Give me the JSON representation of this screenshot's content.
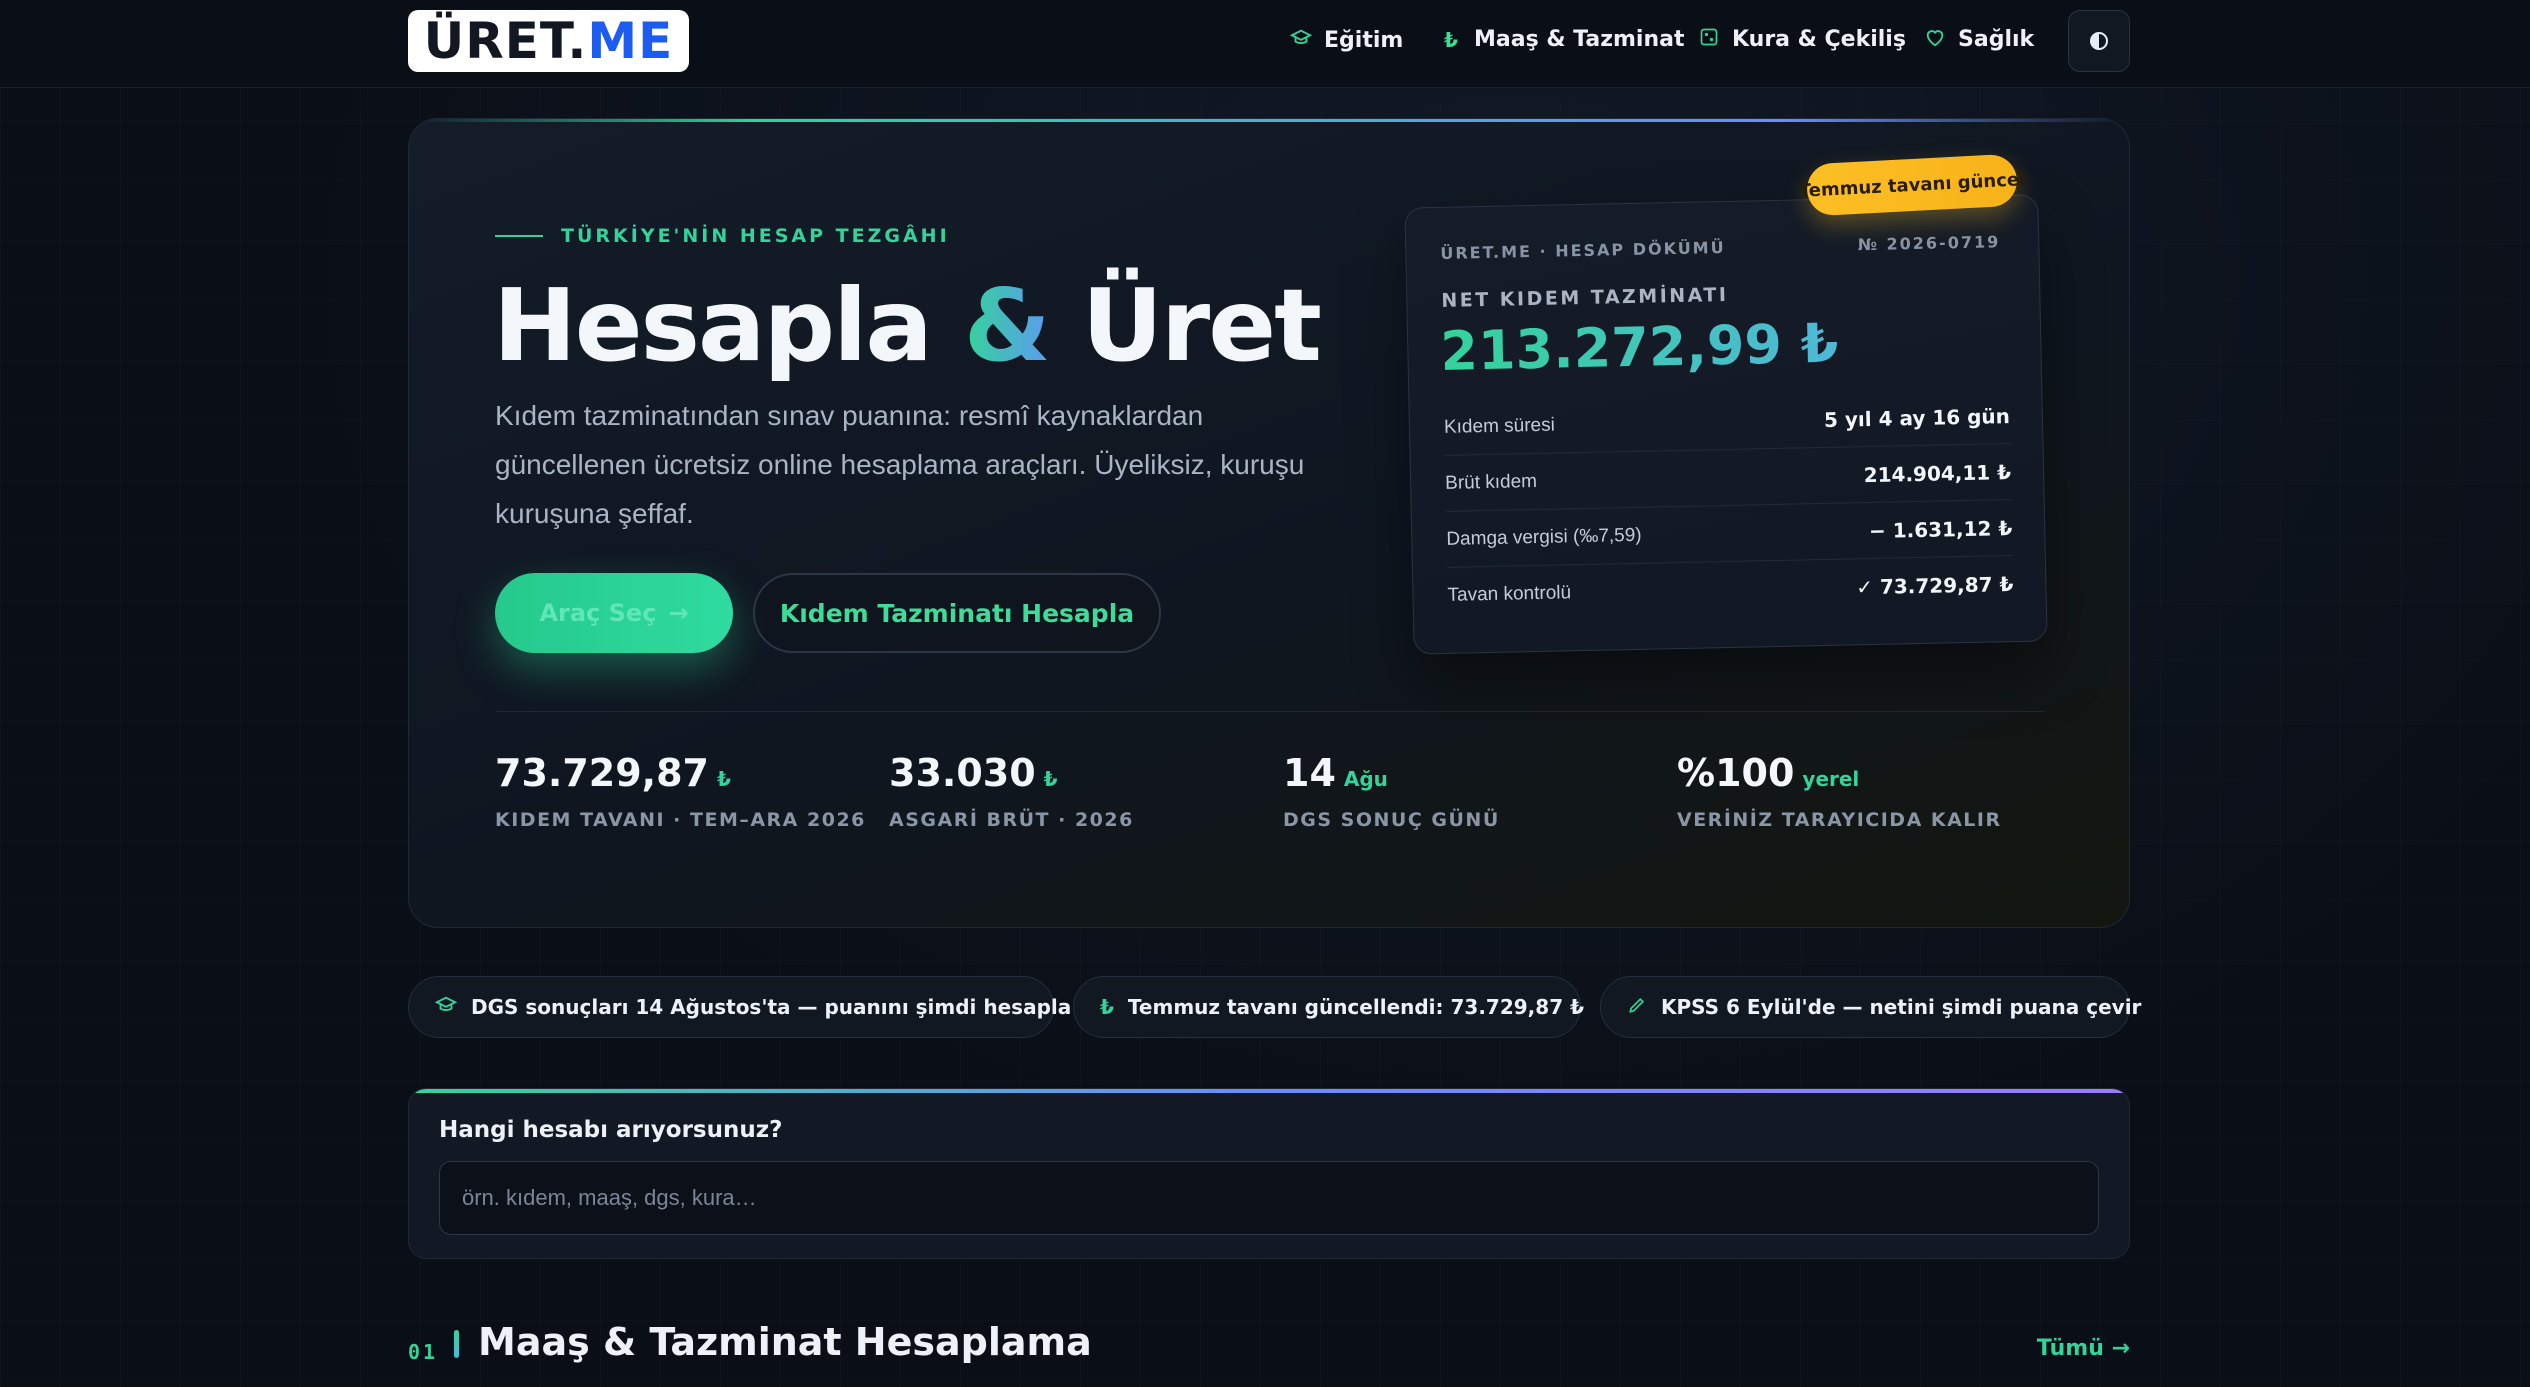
{
  "header": {
    "logo_part1": "ÜRET.",
    "logo_part2": "ME",
    "nav": [
      {
        "label": "Eğitim",
        "icon": "graduation-cap-icon"
      },
      {
        "label": "Maaş & Tazminat",
        "icon": "lira-icon"
      },
      {
        "label": "Kura & Çekiliş",
        "icon": "dice-icon"
      },
      {
        "label": "Sağlık",
        "icon": "heart-icon"
      }
    ],
    "theme_toggle_icon": "contrast-icon"
  },
  "hero": {
    "eyebrow": "TÜRKİYE'NİN HESAP TEZGÂHI",
    "title_part1": "Hesapla",
    "title_amp": "&",
    "title_part2": "Üret",
    "lead": "Kıdem tazminatından sınav puanına: resmî kaynaklardan güncellenen ücretsiz online hesaplama araçları. Üyeliksiz, kuruşu kuruşuna şeffaf.",
    "primary_button": "Araç Seç",
    "primary_button_arrow": "→",
    "secondary_button": "Kıdem Tazminatı Hesapla",
    "stats": [
      {
        "value": "73.729,87",
        "unit": "₺",
        "label": "KIDEM TAVANI · TEM–ARA 2026"
      },
      {
        "value": "33.030",
        "unit": "₺",
        "label": "ASGARİ BRÜT · 2026"
      },
      {
        "value": "14",
        "unit": "Ağu",
        "label": "DGS SONUÇ GÜNÜ"
      },
      {
        "value": "%100",
        "unit": "yerel",
        "label": "VERİNİZ TARAYICIDA KALIR"
      }
    ]
  },
  "receipt": {
    "badge": "Temmuz tavanı güncel",
    "header_left": "ÜRET.ME · HESAP DÖKÜMÜ",
    "header_right": "№ 2026-0719",
    "label": "NET KIDEM TAZMİNATI",
    "amount": "213.272,99 ₺",
    "rows": [
      {
        "key": "Kıdem süresi",
        "value": "5 yıl 4 ay 16 gün"
      },
      {
        "key": "Brüt kıdem",
        "value": "214.904,11 ₺"
      },
      {
        "key": "Damga vergisi (‰7,59)",
        "value": "− 1.631,12 ₺"
      },
      {
        "key": "Tavan kontrolü",
        "value": "✓ 73.729,87 ₺"
      }
    ]
  },
  "announcements": [
    {
      "icon": "graduation-cap-icon",
      "text": "DGS sonuçları 14 Ağustos'ta — puanını şimdi hesapla"
    },
    {
      "icon": "lira-icon",
      "text": "Temmuz tavanı güncellendi: 73.729,87 ₺"
    },
    {
      "icon": "pencil-icon",
      "text": "KPSS 6 Eylül'de — netini şimdi puana çevir"
    }
  ],
  "search": {
    "label": "Hangi hesabı arıyorsunuz?",
    "placeholder": "örn. kıdem, maaş, dgs, kura…",
    "value": ""
  },
  "section": {
    "number": "01",
    "title": "Maaş & Tazminat Hesaplama",
    "all_link": "Tümü →"
  },
  "colors": {
    "accent": "#34d399",
    "background": "#0a0e16",
    "badge": "#fbbf24",
    "brand_blue": "#1d5cf0"
  }
}
